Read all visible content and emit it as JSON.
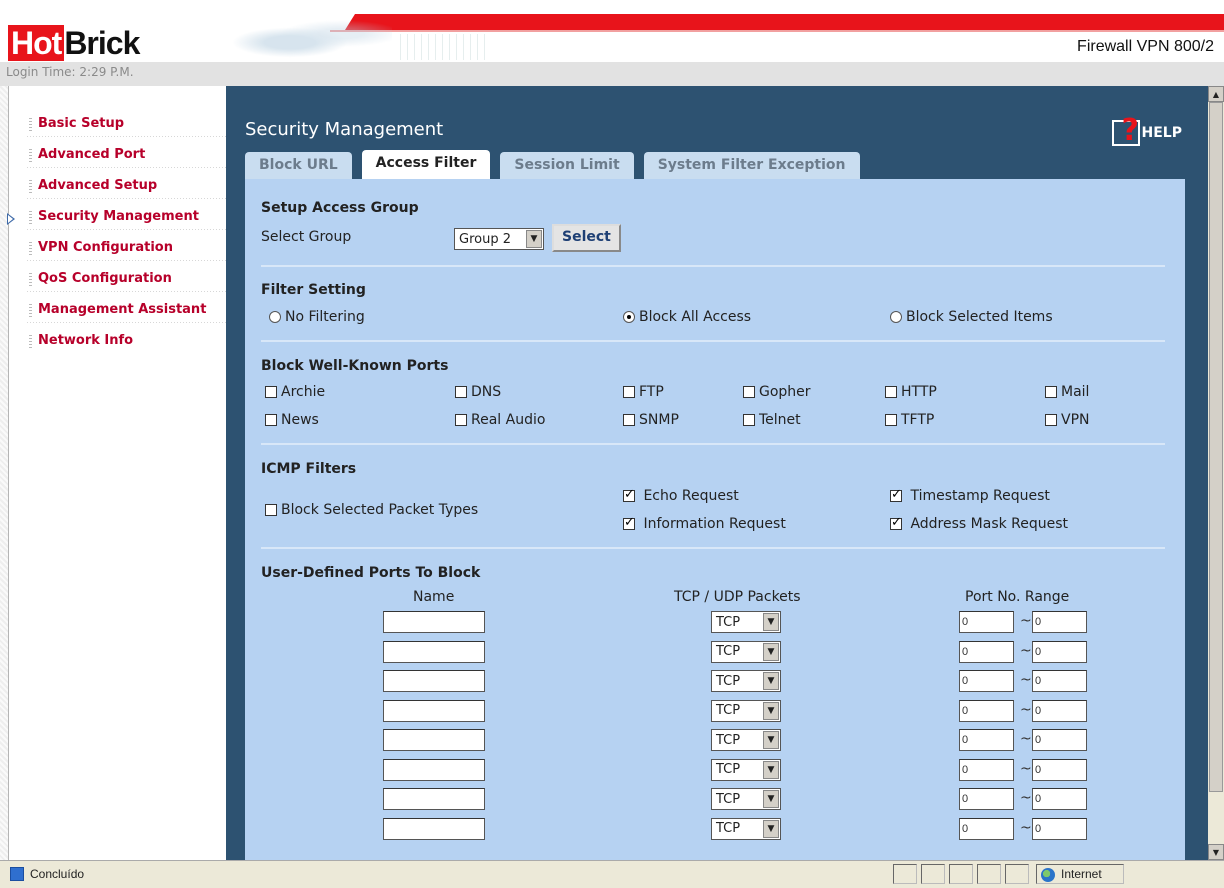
{
  "header": {
    "logo_hot": "Hot",
    "logo_brick": "Brick",
    "model": "Firewall VPN 800/2",
    "login_time": "Login Time: 2:29 P.M."
  },
  "sidebar": {
    "items": [
      {
        "label": "Basic Setup"
      },
      {
        "label": "Advanced Port"
      },
      {
        "label": "Advanced Setup"
      },
      {
        "label": "Security Management",
        "active": true
      },
      {
        "label": "VPN Configuration"
      },
      {
        "label": "QoS Configuration"
      },
      {
        "label": "Management Assistant"
      },
      {
        "label": "Network Info"
      }
    ]
  },
  "main": {
    "title": "Security Management",
    "help_label": "HELP",
    "tabs": [
      {
        "label": "Block URL"
      },
      {
        "label": "Access Filter",
        "active": true
      },
      {
        "label": "Session Limit"
      },
      {
        "label": "System Filter Exception"
      }
    ],
    "access_group": {
      "title": "Setup Access Group",
      "select_label": "Select Group",
      "selected_group": "Group 2",
      "select_button": "Select"
    },
    "filter_setting": {
      "title": "Filter Setting",
      "options": [
        {
          "label": "No Filtering",
          "checked": false
        },
        {
          "label": "Block All Access",
          "checked": true
        },
        {
          "label": "Block Selected Items",
          "checked": false
        }
      ]
    },
    "well_known_ports": {
      "title": "Block Well-Known Ports",
      "items": [
        {
          "label": "Archie",
          "checked": false
        },
        {
          "label": "DNS",
          "checked": false
        },
        {
          "label": "FTP",
          "checked": false
        },
        {
          "label": "Gopher",
          "checked": false
        },
        {
          "label": "HTTP",
          "checked": false
        },
        {
          "label": "Mail",
          "checked": false
        },
        {
          "label": "News",
          "checked": false
        },
        {
          "label": "Real Audio",
          "checked": false
        },
        {
          "label": "SNMP",
          "checked": false
        },
        {
          "label": "Telnet",
          "checked": false
        },
        {
          "label": "TFTP",
          "checked": false
        },
        {
          "label": "VPN",
          "checked": false
        }
      ]
    },
    "icmp": {
      "title": "ICMP Filters",
      "block_label": "Block Selected Packet Types",
      "block_checked": false,
      "types": [
        {
          "label": "Echo Request",
          "checked": true
        },
        {
          "label": "Timestamp Request",
          "checked": true
        },
        {
          "label": "Information Request",
          "checked": true
        },
        {
          "label": "Address Mask Request",
          "checked": true
        }
      ]
    },
    "user_ports": {
      "title": "User-Defined Ports To Block",
      "col_name": "Name",
      "col_proto": "TCP / UDP Packets",
      "col_range": "Port No. Range",
      "range_sep": "~",
      "rows": [
        {
          "name": "",
          "protocol": "TCP",
          "from": "0",
          "to": "0"
        },
        {
          "name": "",
          "protocol": "TCP",
          "from": "0",
          "to": "0"
        },
        {
          "name": "",
          "protocol": "TCP",
          "from": "0",
          "to": "0"
        },
        {
          "name": "",
          "protocol": "TCP",
          "from": "0",
          "to": "0"
        },
        {
          "name": "",
          "protocol": "TCP",
          "from": "0",
          "to": "0"
        },
        {
          "name": "",
          "protocol": "TCP",
          "from": "0",
          "to": "0"
        },
        {
          "name": "",
          "protocol": "TCP",
          "from": "0",
          "to": "0"
        },
        {
          "name": "",
          "protocol": "TCP",
          "from": "0",
          "to": "0"
        }
      ]
    }
  },
  "statusbar": {
    "status": "Concluído",
    "zone": "Internet"
  }
}
